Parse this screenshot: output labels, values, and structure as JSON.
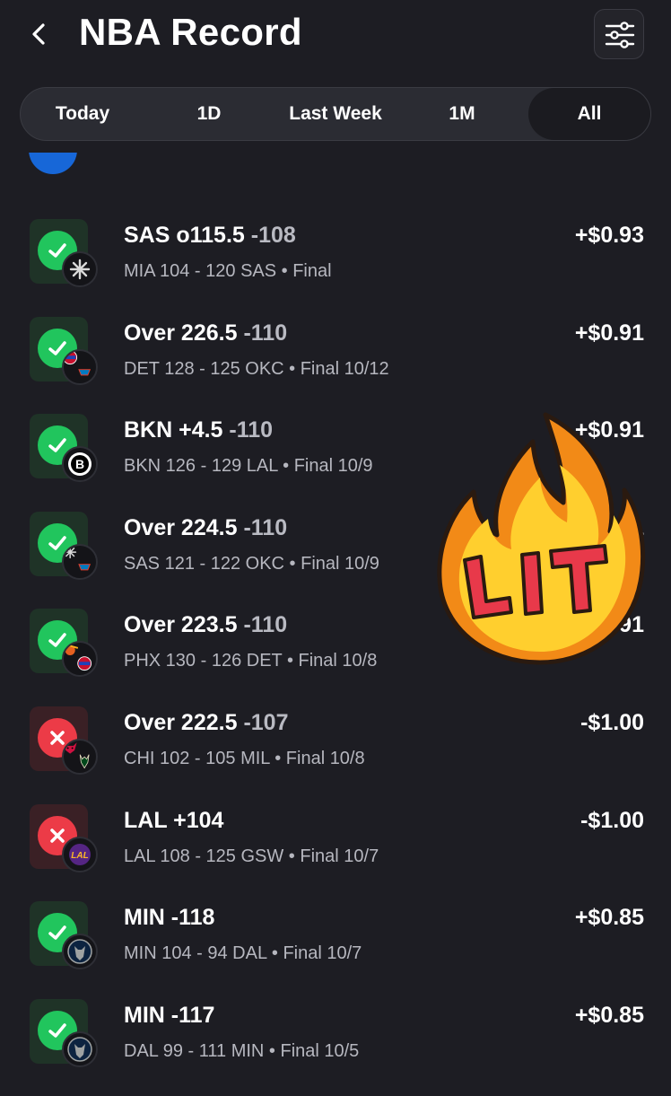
{
  "header": {
    "title": "NBA Record",
    "back_icon": "chevron-left-icon",
    "filter_icon": "sliders-icon"
  },
  "tabs": [
    {
      "label": "Today",
      "active": false
    },
    {
      "label": "1D",
      "active": false
    },
    {
      "label": "Last Week",
      "active": false
    },
    {
      "label": "1M",
      "active": false
    },
    {
      "label": "All",
      "active": true
    }
  ],
  "bets": [
    {
      "pick": "SAS o115.5",
      "odds": "-108",
      "result": "win",
      "logos": [
        "spurs"
      ],
      "game": "MIA 104 - 120 SAS • Final",
      "profit": "+$0.93"
    },
    {
      "pick": "Over 226.5",
      "odds": "-110",
      "result": "win",
      "logos": [
        "pistons",
        "thunder"
      ],
      "game": "DET 128 - 125 OKC • Final 10/12",
      "profit": "+$0.91"
    },
    {
      "pick": "BKN +4.5",
      "odds": "-110",
      "result": "win",
      "logos": [
        "nets"
      ],
      "game": "BKN 126 - 129 LAL • Final 10/9",
      "profit": "+$0.91"
    },
    {
      "pick": "Over 224.5",
      "odds": "-110",
      "result": "win",
      "logos": [
        "spurs",
        "thunder"
      ],
      "game": "SAS 121 - 122 OKC • Final 10/9",
      "profit": "+$0.91"
    },
    {
      "pick": "Over 223.5",
      "odds": "-110",
      "result": "win",
      "logos": [
        "suns",
        "pistons"
      ],
      "game": "PHX 130 - 126 DET • Final 10/8",
      "profit": "+$0.91"
    },
    {
      "pick": "Over 222.5",
      "odds": "-107",
      "result": "loss",
      "logos": [
        "bulls",
        "bucks"
      ],
      "game": "CHI 102 - 105 MIL • Final 10/8",
      "profit": "-$1.00"
    },
    {
      "pick": "LAL +104",
      "odds": "",
      "result": "loss",
      "logos": [
        "lakers"
      ],
      "game": "LAL 108 - 125 GSW • Final 10/7",
      "profit": "-$1.00"
    },
    {
      "pick": "MIN -118",
      "odds": "",
      "result": "win",
      "logos": [
        "timberwolves"
      ],
      "game": "MIN 104 - 94 DAL • Final 10/7",
      "profit": "+$0.85"
    },
    {
      "pick": "MIN -117",
      "odds": "",
      "result": "win",
      "logos": [
        "timberwolves"
      ],
      "game": "DAL 99 - 111 MIN • Final 10/5",
      "profit": "+$0.85"
    }
  ],
  "sticker": {
    "text": "LIT",
    "icon": "fire-sticker-icon"
  },
  "colors": {
    "background": "#1d1d23",
    "win": "#21c55d",
    "loss": "#ec3b47",
    "sticker_text": "#e8394a"
  }
}
